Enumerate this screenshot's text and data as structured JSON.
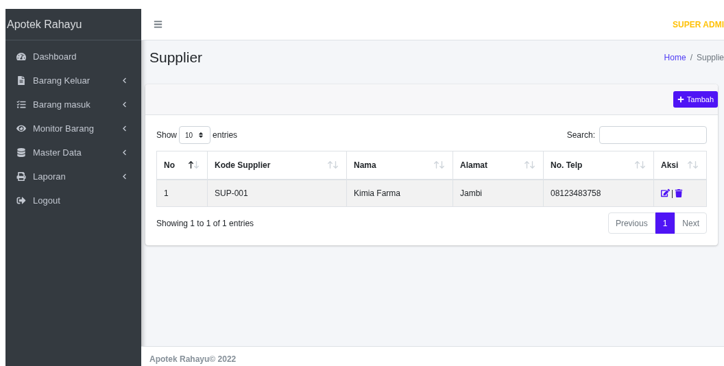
{
  "sidebar": {
    "brand": "Apotek Rahayu",
    "items": [
      {
        "label": "Dashboard",
        "kind": "gauge",
        "submenu": false
      },
      {
        "label": "Barang Keluar",
        "kind": "file",
        "submenu": true
      },
      {
        "label": "Barang masuk",
        "kind": "tasks",
        "submenu": true
      },
      {
        "label": "Monitor Barang",
        "kind": "eye",
        "submenu": true
      },
      {
        "label": "Master Data",
        "kind": "database",
        "submenu": true
      },
      {
        "label": "Laporan",
        "kind": "print",
        "submenu": true
      },
      {
        "label": "Logout",
        "kind": "logout",
        "submenu": false
      }
    ]
  },
  "navbar": {
    "user": "SUPER ADMI"
  },
  "page": {
    "title": "Supplier",
    "breadcrumb": [
      "Home",
      "Supplie"
    ],
    "breadcrumb_separator": "/"
  },
  "card": {
    "add_button": "Tambah",
    "length": {
      "prefix": "Show",
      "value": "10",
      "suffix": "entries"
    },
    "search": {
      "label": "Search:"
    },
    "table": {
      "columns": [
        {
          "label": "No",
          "sorted": true
        },
        {
          "label": "Kode Supplier",
          "sorted": false
        },
        {
          "label": "Nama",
          "sorted": false
        },
        {
          "label": "Alamat",
          "sorted": false
        },
        {
          "label": "No. Telp",
          "sorted": false
        },
        {
          "label": "Aksi",
          "sorted": false
        }
      ],
      "rows": [
        {
          "cells": [
            "1",
            "SUP-001",
            "Kimia Farma",
            "Jambi",
            "08123483758"
          ],
          "separator": "|"
        }
      ]
    },
    "info": "Showing 1 to 1 of 1 entries",
    "pagination": [
      {
        "label": "Previous",
        "selected": false
      },
      {
        "label": "1",
        "selected": true
      },
      {
        "label": "Next",
        "selected": false
      }
    ]
  },
  "footer": {
    "text": "Apotek Rahayu© 2022"
  }
}
